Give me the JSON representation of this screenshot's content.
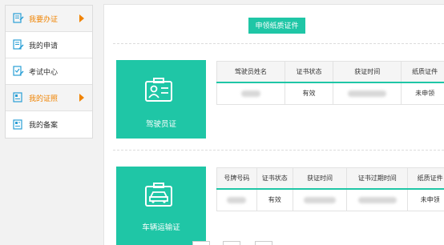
{
  "sidebar": {
    "items": [
      {
        "label": "我要办证",
        "icon": "apply-certificate-icon",
        "highlight": true
      },
      {
        "label": "我的申请",
        "icon": "my-application-icon",
        "highlight": false
      },
      {
        "label": "考试中心",
        "icon": "exam-center-icon",
        "highlight": false
      },
      {
        "label": "我的证照",
        "icon": "my-license-icon",
        "highlight": true
      },
      {
        "label": "我的备案",
        "icon": "my-record-icon",
        "highlight": false
      }
    ]
  },
  "main": {
    "apply_button": "申领纸质证件",
    "driver_card": {
      "title": "驾驶员证",
      "icon": "id-badge-icon"
    },
    "driver_table": {
      "headers": [
        "驾驶员姓名",
        "证书状态",
        "获证时间",
        "纸质证件"
      ],
      "row": {
        "status": "有效",
        "paper": "未申领"
      }
    },
    "vehicle_card": {
      "title": "车辆运输证",
      "icon": "vehicle-badge-icon"
    },
    "vehicle_table": {
      "headers": [
        "号牌号码",
        "证书状态",
        "获证时间",
        "证书过期时间",
        "纸质证件"
      ],
      "row": {
        "status": "有效",
        "paper": "未申领"
      }
    }
  },
  "colors": {
    "accent": "#1fc6a6",
    "highlight": "#f08300"
  }
}
